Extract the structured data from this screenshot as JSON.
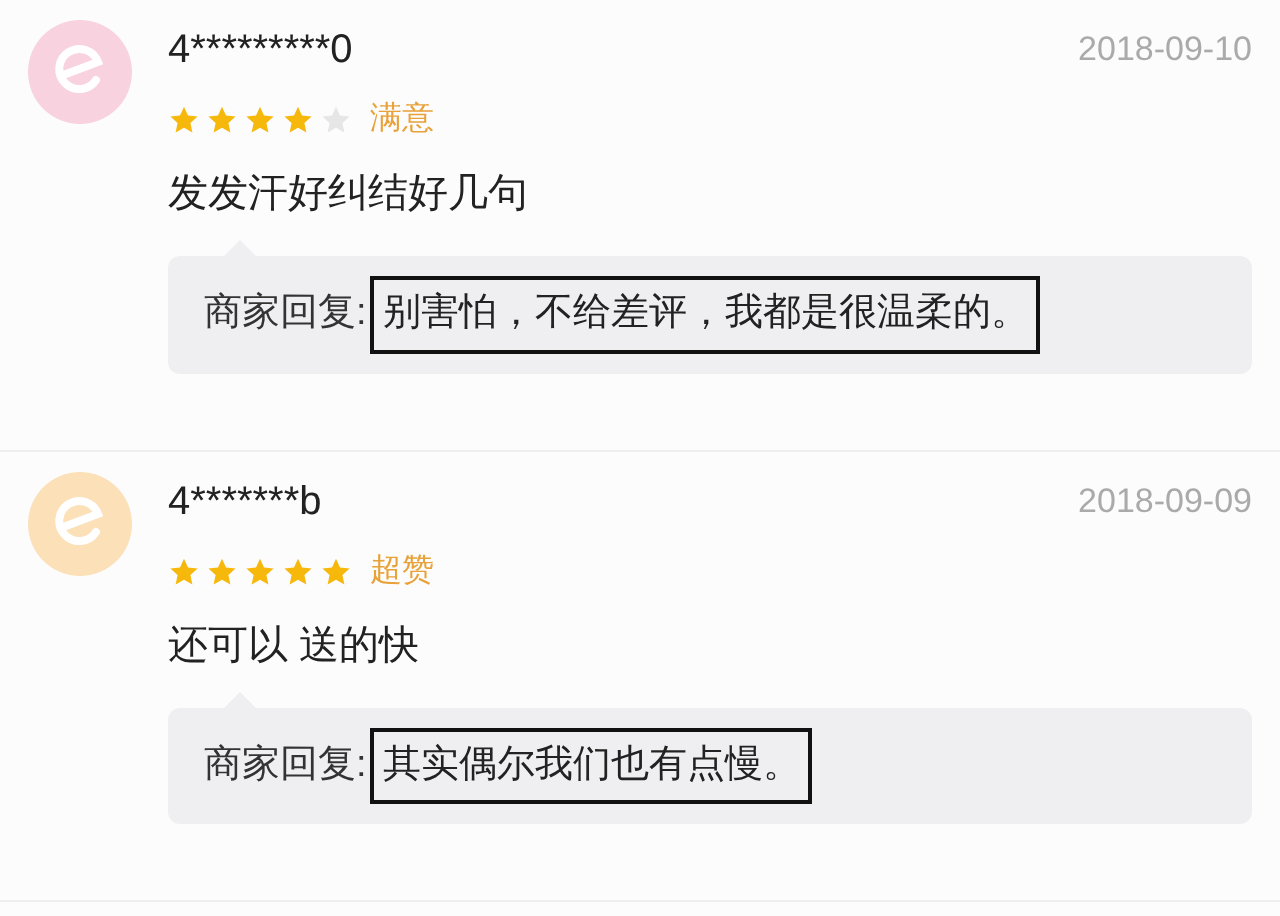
{
  "reviews": [
    {
      "color": "#f8d2de",
      "user": "4*********0",
      "date": "2018-09-10",
      "stars": 4,
      "rating_label": "满意",
      "comment": "发发汗好纠结好几句",
      "reply_label": "商家回复:",
      "reply": "别害怕，不给差评，我都是很温柔的。"
    },
    {
      "color": "#fbe0b8",
      "user": "4*******b",
      "date": "2018-09-09",
      "stars": 5,
      "rating_label": "超赞",
      "comment": "还可以 送的快",
      "reply_label": "商家回复:",
      "reply": "其实偶尔我们也有点慢。"
    }
  ]
}
